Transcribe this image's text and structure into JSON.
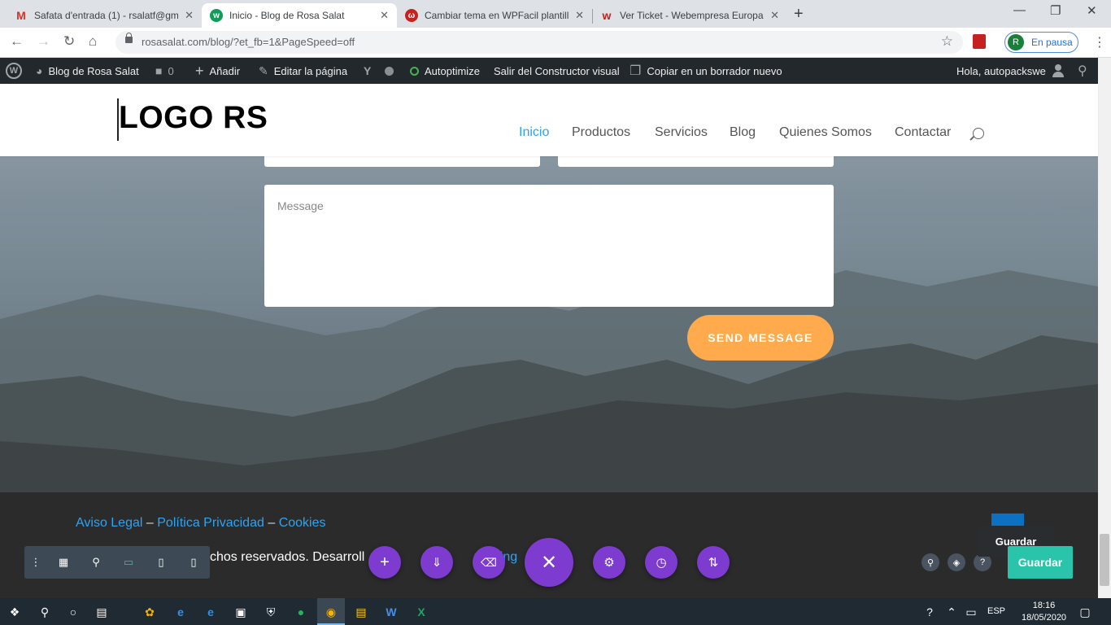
{
  "browser": {
    "tabs": [
      {
        "title": "Safata d'entrada (1) - rsalatf@gm",
        "favicon": "M",
        "favicon_color": "#d93025",
        "close": "✕"
      },
      {
        "title": "Inicio - Blog de Rosa Salat",
        "favicon": "w",
        "favicon_color": "#0f9d58",
        "close": "✕"
      },
      {
        "title": "Cambiar tema en WPFacil plantill",
        "favicon": "ω",
        "favicon_color": "#c5221f",
        "close": "✕"
      },
      {
        "title": "Ver Ticket - Webempresa Europa",
        "favicon": "w",
        "favicon_color": "#c5221f",
        "close": "✕"
      }
    ],
    "new_tab": "+",
    "url": "rosasalat.com/blog/?et_fb=1&PageSpeed=off",
    "profile_initial": "R",
    "profile_status": "En pausa"
  },
  "adminbar": {
    "site_name": "Blog de Rosa Salat",
    "comments_count": "0",
    "add_new": "Añadir",
    "edit_page": "Editar la página",
    "autoptimize": "Autoptimize",
    "exit_builder": "Salir del Constructor visual",
    "copy_draft": "Copiar en un borrador nuevo",
    "greeting": "Hola, autopackswe"
  },
  "site": {
    "logo": "LOGO RS",
    "menu": [
      "Inicio",
      "Productos",
      "Servicios",
      "Blog",
      "Quienes Somos",
      "Contactar"
    ],
    "accent": "#2ea3f2"
  },
  "form": {
    "message_placeholder": "Message",
    "send_label": "SEND MESSAGE",
    "send_color": "#ffaa4d"
  },
  "footer": {
    "link_legal": "Aviso Legal",
    "sep": "–",
    "link_privacy": "Política Privacidad",
    "link_cookies": "Cookies",
    "copyright_visible": "chos reservados. Desarroll",
    "copyright_mid": "por",
    "copyright_tail": "ting"
  },
  "builder": {
    "tooltip": "Guardar",
    "save_label": "Guardar",
    "save_color": "#29c4a9",
    "purple": "#7e3bd0"
  },
  "taskbar": {
    "language": "ESP",
    "time": "18:16",
    "date": "18/05/2020"
  }
}
